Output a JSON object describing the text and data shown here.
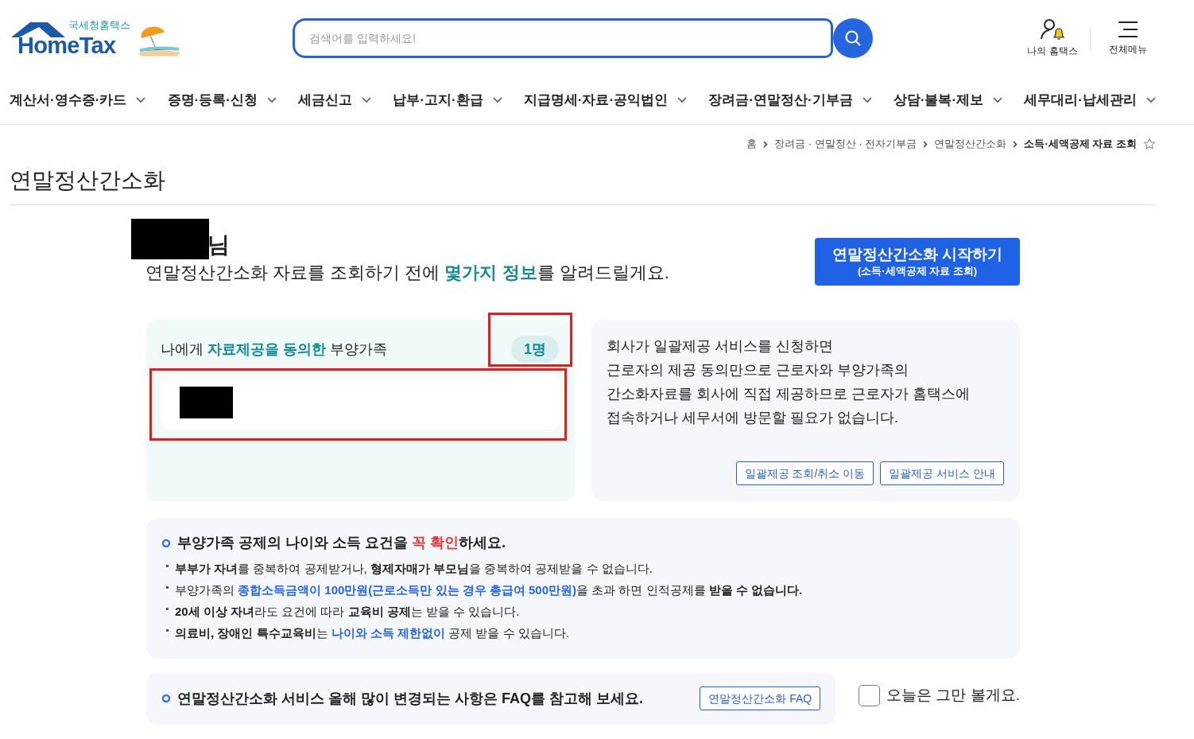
{
  "header": {
    "logo_caption": "국세청홈택스",
    "logo_text": "HomeTax",
    "search": {
      "placeholder": "검색어를 입력하세요!"
    },
    "utilities": [
      {
        "label": "나의 홈택스",
        "kind": "user"
      },
      {
        "label": "전체메뉴",
        "kind": "menu"
      }
    ]
  },
  "nav": [
    "계산서·영수증·카드",
    "증명·등록·신청",
    "세금신고",
    "납부·고지·환급",
    "지급명세·자료·공익법인",
    "장려금·연말정산·기부금",
    "상담·불복·제보",
    "세무대리·납세관리"
  ],
  "breadcrumb": [
    "홈",
    "장려금 · 연말정산 · 전자기부금",
    "연말정산간소화",
    "소득·세액공제 자료 조회"
  ],
  "page_title": "연말정산간소화",
  "greeting": {
    "suffix": "님",
    "message": [
      {
        "text": "연말정산간소화 자료를 조회하기 전에 ",
        "kind": "plain"
      },
      {
        "text": "몇가지 정보",
        "kind": "teal"
      },
      {
        "text": "를 알려드릴게요.",
        "kind": "plain"
      }
    ]
  },
  "start_button": {
    "label": "연말정산간소화 시작하기",
    "sub": "(소득·세액공제 자료 조회)"
  },
  "dependents_card": {
    "title": [
      {
        "text": "나에게 ",
        "kind": "plain"
      },
      {
        "text": "자료제공을 동의한",
        "kind": "teal"
      },
      {
        "text": " 부양가족",
        "kind": "plain"
      }
    ],
    "count": "1명"
  },
  "bulk_card": {
    "lines": [
      "회사가 일괄제공 서비스를 신청하면",
      "근로자의 제공 동의만으로 근로자와 부양가족의",
      "간소화자료를 회사에 직접 제공하므로 근로자가 홈택스에",
      "접속하거나 세무서에 방문할 필요가 없습니다."
    ],
    "buttons": [
      "일괄제공 조회/취소 이동",
      "일괄제공 서비스 안내"
    ]
  },
  "notice": {
    "heading": [
      {
        "text": "부양가족 공제의 나이와 소득 요건을 ",
        "kind": "bold"
      },
      {
        "text": "꼭 확인",
        "kind": "red"
      },
      {
        "text": "하세요.",
        "kind": "bold"
      }
    ],
    "items": [
      [
        {
          "text": "부부가 자녀",
          "kind": "bold"
        },
        {
          "text": "를 중복하여 공제받거나, ",
          "kind": "plain"
        },
        {
          "text": "형제자매가 부모님",
          "kind": "bold"
        },
        {
          "text": "을 중복하여 공제받을 수 없습니다.",
          "kind": "plain"
        }
      ],
      [
        {
          "text": "부양가족의 ",
          "kind": "plain"
        },
        {
          "text": "종합소득금액이 100만원(근로소득만 있는 경우 총급여 500만원)",
          "kind": "blue"
        },
        {
          "text": "을 초과 하면 인적공제를 ",
          "kind": "plain"
        },
        {
          "text": "받을 수 없습니다.",
          "kind": "bold"
        }
      ],
      [
        {
          "text": "20세 이상 자녀",
          "kind": "bold"
        },
        {
          "text": "라도 요건에 따라 ",
          "kind": "plain"
        },
        {
          "text": "교육비 공제",
          "kind": "bold"
        },
        {
          "text": "는 받을 수 있습니다.",
          "kind": "plain"
        }
      ],
      [
        {
          "text": "의료비, 장애인 특수교육비",
          "kind": "bold"
        },
        {
          "text": "는 ",
          "kind": "plain"
        },
        {
          "text": "나이와 소득 제한없이",
          "kind": "blue"
        },
        {
          "text": " 공제 받을 수 있습니다.",
          "kind": "plain"
        }
      ]
    ]
  },
  "faq": {
    "text": "연말정산간소화 서비스 올해 많이 변경되는 사항은 FAQ를 참고해 보세요.",
    "button": "연말정산간소화 FAQ"
  },
  "dismiss": {
    "label": "오늘은 그만 볼게요.",
    "checked": false
  }
}
